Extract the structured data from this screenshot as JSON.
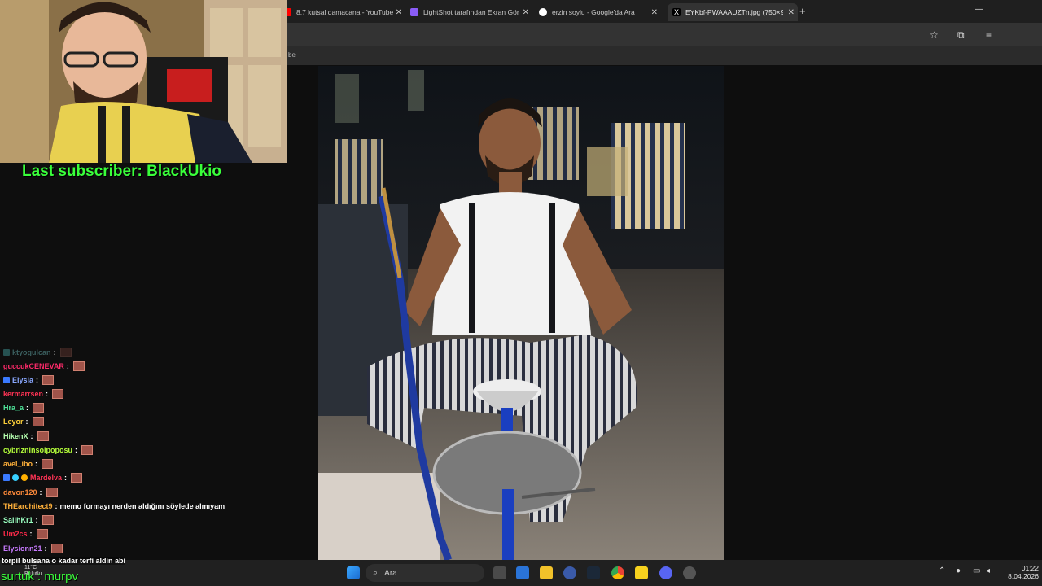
{
  "browser": {
    "tabs": [
      {
        "title": "8.7 kutsal damacana - YouTube",
        "favicon_color": "#ff0000"
      },
      {
        "title": "LightShot tarafından Ekran Gör",
        "favicon_color": "#8a5cf6"
      },
      {
        "title": "erzin soylu - Google'da Ara",
        "favicon_color": "#ffffff"
      },
      {
        "title": "EYKbf-PWAAAUZTn.jpg (750×9",
        "favicon_color": "#000000"
      }
    ],
    "bookmark_fragment": "be"
  },
  "overlay": {
    "last_subscriber": "Last subscriber: BlackUkio",
    "chat": [
      {
        "user": "ktyogulcan",
        "color": "#5fa0a0",
        "message": ""
      },
      {
        "user": "guccukCENEVAR",
        "color": "#ff2a6a",
        "message": ""
      },
      {
        "user": "Elysia",
        "color": "#8aa8ff",
        "message": ""
      },
      {
        "user": "kermarrsen",
        "color": "#ff3355",
        "message": ""
      },
      {
        "user": "Hra_a",
        "color": "#4fe39a",
        "message": ""
      },
      {
        "user": "Leyor",
        "color": "#ffd23a",
        "message": ""
      },
      {
        "user": "HikenX",
        "color": "#b6ffb0",
        "message": ""
      },
      {
        "user": "cybrlzninsolpoposu",
        "color": "#b5ff3a",
        "message": ""
      },
      {
        "user": "avel_ibo",
        "color": "#ffb03a",
        "message": ""
      },
      {
        "user": "Mardelva",
        "color": "#ff3355",
        "message": ""
      },
      {
        "user": "davon120",
        "color": "#ff8a3a",
        "message": ""
      },
      {
        "user": "THEarchitect9",
        "color": "#ffb03a",
        "message": "memo formayı nerden aldığını söylede almıyam"
      },
      {
        "user": "SalihKr1",
        "color": "#9affc0",
        "message": ""
      },
      {
        "user": "Um2cs",
        "color": "#ff2a4a",
        "message": ""
      },
      {
        "user": "Elysionn21",
        "color": "#c87aff",
        "message": ""
      }
    ],
    "bottom_message": "torpil bulsana o kadar terfi aldin abi",
    "bottom_green": "surtuk : murpv"
  },
  "taskbar": {
    "search_placeholder": "Ara",
    "weather_temp": "11°C",
    "weather_desc": "Bulutlu",
    "time": "01:22",
    "date": "8.04.2026"
  }
}
